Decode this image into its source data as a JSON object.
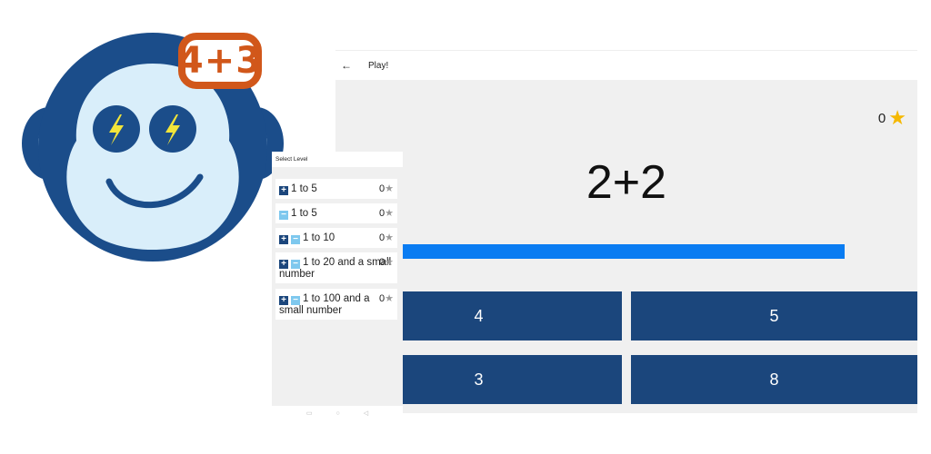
{
  "badge": {
    "text": "4+3"
  },
  "colors": {
    "accent": "#0a7cf2",
    "answer_bg": "#1b467c",
    "badge": "#d1571a",
    "mascot_dark": "#1b4d8a",
    "mascot_light": "#d9eefa",
    "star": "#f5b800"
  },
  "tablet": {
    "appbar": {
      "back_icon": "←",
      "title": "Play!"
    },
    "score": {
      "value": "0",
      "icon": "star-icon"
    },
    "problem": "2+2",
    "progress": 1.0,
    "answers": [
      "4",
      "5",
      "3",
      "8"
    ]
  },
  "phone": {
    "header": "Select Level",
    "levels": [
      {
        "icons": [
          "plus"
        ],
        "label": "1 to 5",
        "score": "0"
      },
      {
        "icons": [
          "minus"
        ],
        "label": "1 to 5",
        "score": "0"
      },
      {
        "icons": [
          "plus",
          "minus"
        ],
        "label": "1 to 10",
        "score": "0"
      },
      {
        "icons": [
          "plus",
          "minus"
        ],
        "label": "1 to 20 and a small number",
        "score": "0"
      },
      {
        "icons": [
          "plus",
          "minus"
        ],
        "label": "1 to 100 and a small number",
        "score": "0"
      }
    ],
    "nav": [
      "▭",
      "○",
      "◁"
    ]
  }
}
